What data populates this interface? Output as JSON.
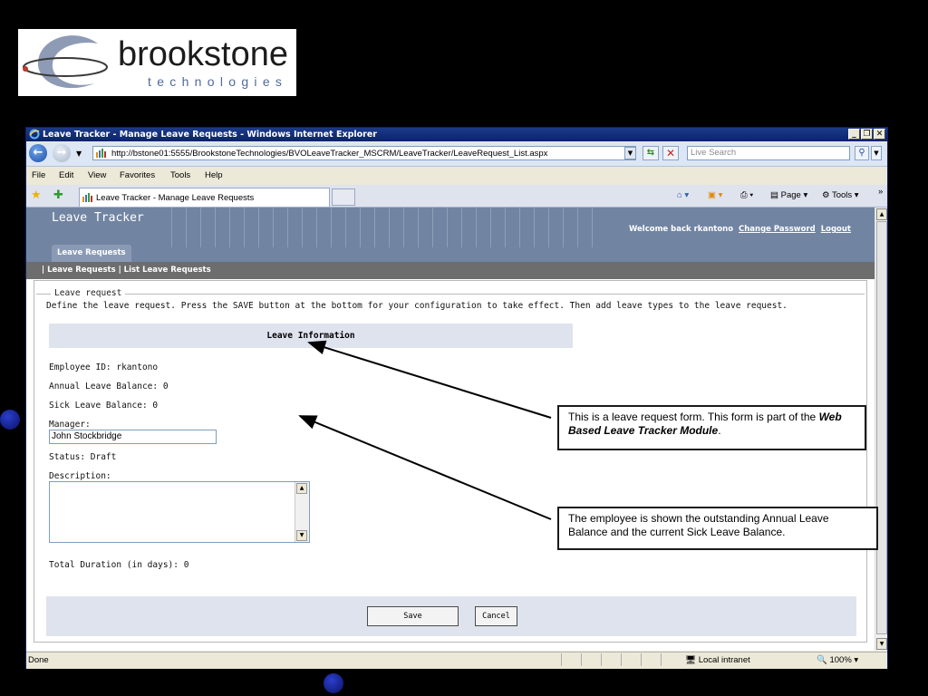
{
  "logo": {
    "name": "brookstone",
    "sub": "technologies"
  },
  "browser": {
    "window_title": "Leave Tracker - Manage Leave Requests - Windows Internet Explorer",
    "url": "http://bstone01:5555/BrookstoneTechnologies/BVOLeaveTracker_MSCRM/LeaveTracker/LeaveRequest_List.aspx",
    "search_placeholder": "Live Search",
    "menu": [
      "File",
      "Edit",
      "View",
      "Favorites",
      "Tools",
      "Help"
    ],
    "tab_label": "Leave Tracker - Manage Leave Requests",
    "commands": {
      "page": "Page",
      "tools": "Tools"
    },
    "status": {
      "done": "Done",
      "zone": "Local intranet",
      "zoom": "100%"
    }
  },
  "app": {
    "title": "Leave Tracker",
    "welcome": "Welcome back rkantono",
    "change_password": "Change Password",
    "logout": "Logout",
    "tab": "Leave Requests",
    "subnav": "| Leave Requests | List Leave Requests"
  },
  "form": {
    "legend": "Leave request",
    "intro": "Define the leave request. Press the SAVE button at the bottom for your configuration to take effect. Then add leave types to the leave request.",
    "section_title": "Leave Information",
    "employee_id": "Employee ID:  rkantono",
    "annual_balance": "Annual Leave Balance:  0",
    "sick_balance": "Sick Leave Balance:  0",
    "manager_label": "Manager:",
    "manager_value": "John Stockbridge",
    "status": "Status:  Draft",
    "description_label": "Description:",
    "total_duration": "Total Duration (in days):  0",
    "save_label": "Save",
    "cancel_label": "Cancel"
  },
  "callouts": {
    "first_pre": "This is a leave request form. This form is part of the ",
    "first_bold": "Web Based Leave Tracker Module",
    "first_post": ".",
    "second": "The employee is shown the outstanding Annual Leave Balance and the current Sick Leave Balance."
  }
}
